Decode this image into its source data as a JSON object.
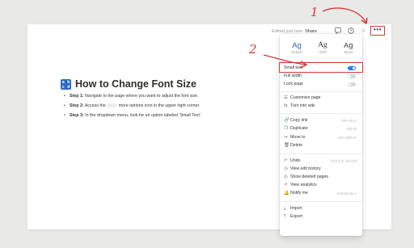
{
  "topbar": {
    "edited": "Edited just now",
    "share": "Share",
    "more": "•••",
    "icons": [
      "comment-icon",
      "history-icon",
      "star-icon"
    ]
  },
  "page": {
    "title": "How to Change Font Size",
    "icon_text": [
      "a",
      "b",
      "c",
      "d"
    ],
    "steps": [
      {
        "label": "Step 1:",
        "text": " Navigate to the page where you want to adjust the font size."
      },
      {
        "label": "Step 2:",
        "text_before": " Access the ",
        "text_after": " more options icon in the upper right corner."
      },
      {
        "label": "Step 3:",
        "text": " In the dropdown menu, look for an option labeled 'Small Text'."
      }
    ]
  },
  "menu": {
    "fonts": [
      {
        "sample": "Ag",
        "label": "Default"
      },
      {
        "sample": "Ag",
        "label": "Serif"
      },
      {
        "sample": "Ag",
        "label": "Mono"
      }
    ],
    "toggles": [
      {
        "label": "Small text",
        "on": true
      },
      {
        "label": "Full width",
        "on": false
      },
      {
        "label": "Lock page",
        "on": false
      }
    ],
    "group2": [
      {
        "icon": "customize-icon",
        "glyph": "☰",
        "label": "Customize page"
      },
      {
        "icon": "turn-into-icon",
        "glyph": "⇆",
        "label": "Turn into wiki"
      }
    ],
    "group3": [
      {
        "icon": "link-icon",
        "glyph": "🔗",
        "label": "Copy link",
        "shortcut": "Ctrl+Alt+L"
      },
      {
        "icon": "duplicate-icon",
        "glyph": "❐",
        "label": "Duplicate",
        "shortcut": "Ctrl+D"
      },
      {
        "icon": "move-icon",
        "glyph": "↪",
        "label": "Move to",
        "shortcut": "Ctrl+Shift+P"
      },
      {
        "icon": "trash-icon",
        "glyph": "🗑",
        "label": "Delete",
        "shortcut": ""
      }
    ],
    "group4": [
      {
        "icon": "undo-icon",
        "glyph": "↶",
        "label": "Undo",
        "shortcut": "Ctrl+Z or Alt+Ctrl"
      },
      {
        "icon": "history-icon",
        "glyph": "◷",
        "label": "View edit history",
        "shortcut": ""
      },
      {
        "icon": "deleted-pages-icon",
        "glyph": "◎",
        "label": "Show deleted pages",
        "shortcut": ""
      },
      {
        "icon": "analytics-icon",
        "glyph": "↗",
        "label": "View analytics",
        "shortcut": ""
      },
      {
        "icon": "bell-icon",
        "glyph": "🔔",
        "label": "Notify me",
        "shortcut": "Comments >"
      }
    ],
    "group5": [
      {
        "icon": "import-icon",
        "glyph": "⤓",
        "label": "Import"
      },
      {
        "icon": "export-icon",
        "glyph": "⤒",
        "label": "Export"
      }
    ]
  },
  "annotations": {
    "one": "1",
    "two": "2"
  },
  "colors": {
    "annotation_red": "#d23b36",
    "toggle_on": "#2383e2",
    "title_icon": "#2d6bc6"
  }
}
